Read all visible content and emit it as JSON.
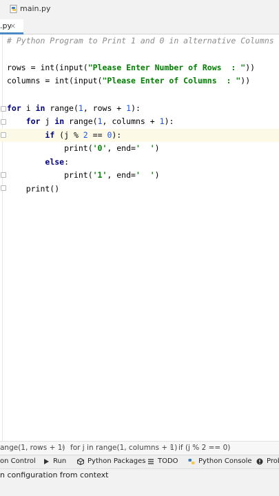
{
  "navbar": {
    "crumbs": [
      {
        "label": "",
        "chevron": "›"
      },
      {
        "label": "main.py",
        "icon": "python-file-icon"
      }
    ]
  },
  "tabs": [
    {
      "label": ".py",
      "close": "×"
    }
  ],
  "editor": {
    "lines": [
      "# Python Program to Print 1 and 0 in alternative Columns",
      "",
      "rows = int(input(\"Please Enter Number of Rows  : \"))",
      "columns = int(input(\"Please Enter of Columns  : \"))",
      "",
      "for i in range(1, rows + 1):",
      "    for j in range(1, columns + 1):",
      "        if (j % 2 == 0):",
      "            print('0', end='  ')",
      "        else:",
      "            print('1', end='  ')",
      "    print()"
    ]
  },
  "breadcrumbs": [
    "ange(1, rows + 1)",
    "for j in range(1, columns + 1)",
    "if (j % 2 == 0)"
  ],
  "breadcrumb_separator": "›",
  "tool_windows": [
    {
      "label": "on Control",
      "icon": "version-control-icon"
    },
    {
      "label": "Run",
      "icon": "run-icon"
    },
    {
      "label": "Python Packages",
      "icon": "python-packages-icon"
    },
    {
      "label": "TODO",
      "icon": "todo-icon"
    },
    {
      "label": "Python Console",
      "icon": "python-console-icon"
    },
    {
      "label": "Prob",
      "icon": "problems-icon"
    }
  ],
  "status": {
    "message": "n configuration from context"
  }
}
